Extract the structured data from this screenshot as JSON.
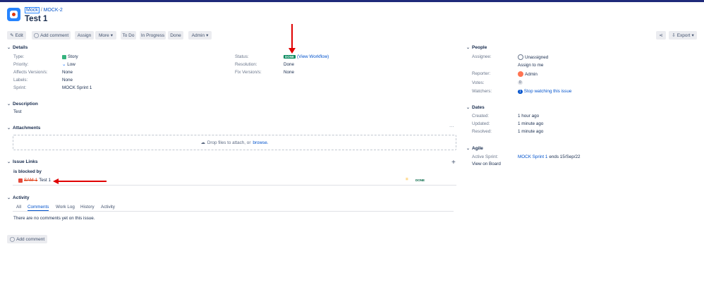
{
  "breadcrumb": {
    "project": "Mock",
    "issue_key": "MOCK-2"
  },
  "issue": {
    "title": "Test 1"
  },
  "toolbar": {
    "edit": "Edit",
    "add_comment": "Add comment",
    "assign": "Assign",
    "more": "More",
    "to_do": "To Do",
    "in_progress": "In Progress",
    "done": "Done",
    "admin": "Admin",
    "export": "Export"
  },
  "details": {
    "heading": "Details",
    "type_label": "Type:",
    "type_value": "Story",
    "priority_label": "Priority:",
    "priority_value": "Low",
    "affects_label": "Affects Version/s:",
    "affects_value": "None",
    "labels_label": "Labels:",
    "labels_value": "None",
    "sprint_label": "Sprint:",
    "sprint_value": "MOCK Sprint 1",
    "status_label": "Status:",
    "status_value": "DONE",
    "view_workflow": "(View Workflow)",
    "resolution_label": "Resolution:",
    "resolution_value": "Done",
    "fix_label": "Fix Version/s:",
    "fix_value": "None"
  },
  "description": {
    "heading": "Description",
    "text": "Test"
  },
  "attachments": {
    "heading": "Attachments",
    "drop_text": "Drop files to attach, or",
    "browse": "browse.",
    "more": "···"
  },
  "issue_links": {
    "heading": "Issue Links",
    "add": "+",
    "relation": "is blocked by",
    "link_key": "SAM-1",
    "link_title": "Test 1",
    "link_priority": "=",
    "link_status": "DONE"
  },
  "activity": {
    "heading": "Activity",
    "tabs": [
      "All",
      "Comments",
      "Work Log",
      "History",
      "Activity"
    ],
    "empty": "There are no comments yet on this issue.",
    "add_comment": "Add comment"
  },
  "people": {
    "heading": "People",
    "assignee_label": "Assignee:",
    "assignee_value": "Unassigned",
    "assign_to_me": "Assign to me",
    "reporter_label": "Reporter:",
    "reporter_value": "Admin",
    "votes_label": "Votes:",
    "votes_value": "0",
    "watchers_label": "Watchers:",
    "watchers_count": "1",
    "watchers_value": "Stop watching this issue"
  },
  "dates": {
    "heading": "Dates",
    "created_label": "Created:",
    "created_value": "1 hour ago",
    "updated_label": "Updated:",
    "updated_value": "1 minute ago",
    "resolved_label": "Resolved:",
    "resolved_value": "1 minute ago"
  },
  "agile": {
    "heading": "Agile",
    "sprint_label": "Active Sprint:",
    "sprint_link": "MOCK Sprint 1",
    "sprint_end": "ends 15/Sep/22",
    "view_board": "View on Board"
  }
}
